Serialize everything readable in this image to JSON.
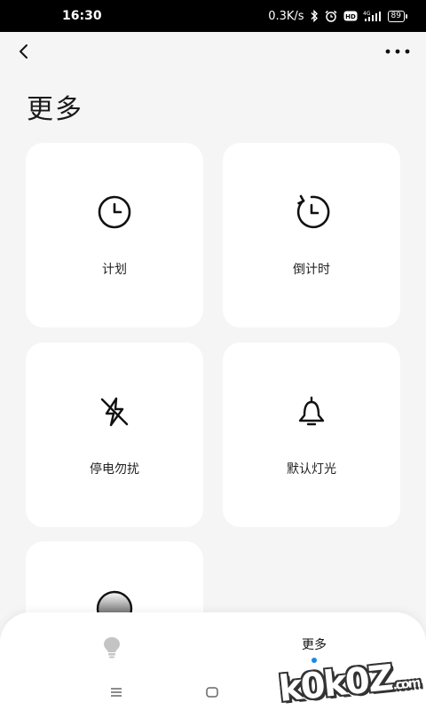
{
  "status_bar": {
    "time": "16:30",
    "speed": "0.3K/s",
    "network": "4G",
    "battery": "89"
  },
  "header": {
    "title": "更多"
  },
  "cards": [
    {
      "label": "计划",
      "icon": "clock-icon"
    },
    {
      "label": "倒计时",
      "icon": "countdown-clock-icon"
    },
    {
      "label": "停电勿扰",
      "icon": "flash-off-icon"
    },
    {
      "label": "默认灯光",
      "icon": "bell-icon"
    },
    {
      "label": "",
      "icon": "gradient-circle-icon"
    }
  ],
  "bottom_nav": {
    "tabs": [
      {
        "label": "",
        "icon": "bulb-icon",
        "active": false
      },
      {
        "label": "更多",
        "icon": "",
        "active": true
      }
    ],
    "accent": "#1e88e5"
  },
  "watermark": {
    "text": "k0k0Z",
    "suffix": ".com"
  }
}
